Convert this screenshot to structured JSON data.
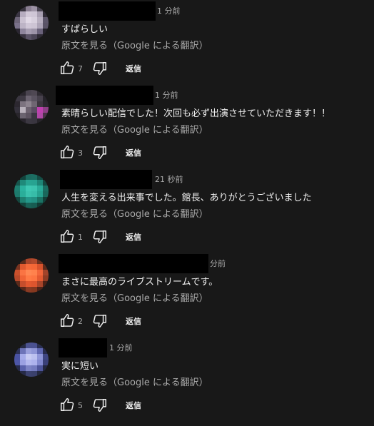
{
  "comments": [
    {
      "timestamp": "1 分前",
      "text": "すばらしい",
      "translate": "原文を見る（Google による翻訳）",
      "likes": "7",
      "reply": "返信",
      "avatar_colors": [
        "#181818",
        "#3a3540",
        "#8a7f92",
        "#9e94a6",
        "#4a4552",
        "#181818",
        "#3b3644",
        "#b7adc0",
        "#d2c9d8",
        "#cfc6d6",
        "#a9a0b2",
        "#2f2b35",
        "#6d6578",
        "#cbc2d2",
        "#e1d9e6",
        "#d8d0de",
        "#b9b0c1",
        "#5d566a",
        "#7a728a",
        "#bdb4c6",
        "#d0c7d7",
        "#cdc4d4",
        "#aea5b8",
        "#5a5366",
        "#2b2732",
        "#8e859c",
        "#a79eb2",
        "#9d94a8",
        "#6a627a",
        "#24212a",
        "#181818",
        "#3a3542",
        "#5a5366",
        "#4b4556",
        "#2e2a34",
        "#181818"
      ]
    },
    {
      "timestamp": "1 分前",
      "text": "素晴らしい配信でした！次回も必ず出演させていただきます！！",
      "translate": "原文を見る（Google による翻訳）",
      "likes": "3",
      "reply": "返信",
      "avatar_colors": [
        "#181818",
        "#2a262d",
        "#4a444f",
        "#4f4853",
        "#2e2a31",
        "#181818",
        "#3a3640",
        "#3f3a44",
        "#6b6370",
        "#5a5360",
        "#47414c",
        "#26232a",
        "#2c2830",
        "#7c737f",
        "#8d848f",
        "#6f6672",
        "#3d3740",
        "#2a262d",
        "#33303a",
        "#b9b2bc",
        "#6d6370",
        "#5b4c62",
        "#c040b0",
        "#8e3f86",
        "#28252b",
        "#6b6470",
        "#5c5360",
        "#3b3641",
        "#b048a6",
        "#4a3148",
        "#181818",
        "#2a262e",
        "#3c3842",
        "#3a3640",
        "#28252b",
        "#181818"
      ]
    },
    {
      "timestamp": "21 秒前",
      "text": "人生を変える出来事でした。館長、ありがとうございました",
      "translate": "原文を見る（Google による翻訳）",
      "likes": "1",
      "reply": "返信",
      "avatar_colors": [
        "#181818",
        "#12443d",
        "#1c6b60",
        "#1c6e62",
        "#144d45",
        "#181818",
        "#17564d",
        "#1f8a7a",
        "#27a592",
        "#27a391",
        "#1e8576",
        "#14463f",
        "#1e7e70",
        "#2bb39f",
        "#3ec8b3",
        "#3cc4af",
        "#29ab98",
        "#1b6d61",
        "#1d7a6c",
        "#2aae9a",
        "#3bc2ad",
        "#37bca8",
        "#26a28f",
        "#1a675b",
        "#14473f",
        "#1e8171",
        "#24978a",
        "#229183",
        "#1b7264",
        "#123e37",
        "#181818",
        "#13443c",
        "#186156",
        "#175c52",
        "#113c35",
        "#181818"
      ]
    },
    {
      "timestamp": "分前",
      "text": "まさに最高のライブストリームです。",
      "translate": "原文を見る（Google による翻訳）",
      "likes": "2",
      "reply": "返信",
      "avatar_colors": [
        "#181818",
        "#5a2a1a",
        "#a9452a",
        "#b24a2c",
        "#6a301e",
        "#181818",
        "#7a3420",
        "#e0592f",
        "#f66a39",
        "#f56736",
        "#d8532c",
        "#5e2a1a",
        "#c9502c",
        "#fa7443",
        "#ff8752",
        "#ff824d",
        "#f2663a",
        "#a2442a",
        "#b8492a",
        "#f06436",
        "#ff7a45",
        "#fd7542",
        "#e45a31",
        "#8f3c24",
        "#5d2a1a",
        "#c64e2c",
        "#e2582f",
        "#dd552e",
        "#a8452a",
        "#4a2116",
        "#181818",
        "#5b2819",
        "#8a3a23",
        "#85381f",
        "#4e2318",
        "#181818"
      ]
    },
    {
      "timestamp": "1 分前",
      "text": "実に短い",
      "translate": "原文を見る（Google による翻訳）",
      "likes": "5",
      "reply": "返信",
      "avatar_colors": [
        "#181818",
        "#262a44",
        "#4b5290",
        "#4a5191",
        "#2a2f52",
        "#181818",
        "#2c3158",
        "#6d74b8",
        "#9aa0dc",
        "#8e95d6",
        "#6068b2",
        "#272b4c",
        "#4a53a2",
        "#a6acea",
        "#c7cbf3",
        "#bcc1f0",
        "#8f96d8",
        "#3f4682",
        "#4d56a6",
        "#9ba1e2",
        "#b4b9ee",
        "#adb2ec",
        "#838ad0",
        "#3a4078",
        "#262a4a",
        "#5a62ac",
        "#7c83c4",
        "#747bbf",
        "#4e559a",
        "#22263f",
        "#181818",
        "#262a46",
        "#3c4270",
        "#3a406c",
        "#24283f",
        "#181818"
      ]
    }
  ]
}
